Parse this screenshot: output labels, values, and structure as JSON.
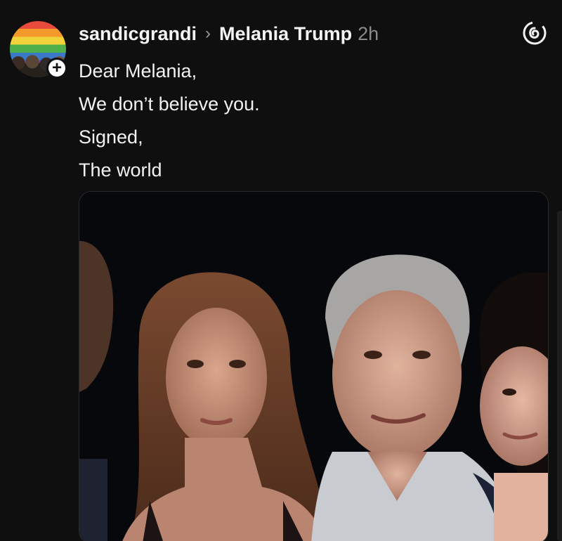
{
  "post": {
    "username": "sandicgrandi",
    "reply_to": "Melania Trump",
    "time": "2h",
    "lines": [
      "Dear Melania,",
      "We don’t believe you.",
      "Signed,",
      "The world"
    ]
  },
  "icons": {
    "chevron": "›",
    "follow": "+",
    "threads": "threads-logo-icon"
  },
  "colors": {
    "background": "#0f0f10",
    "text": "#f2f2f2",
    "muted": "#8a8a8a"
  }
}
